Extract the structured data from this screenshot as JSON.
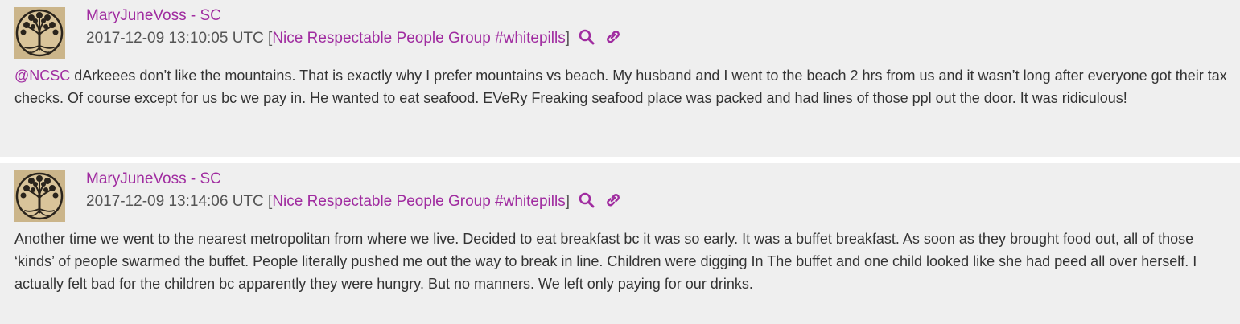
{
  "accent_color": "#a02ca0",
  "posts": [
    {
      "author": "MaryJuneVoss - SC",
      "timestamp": "2017-12-09 13:10:05 UTC",
      "open_bracket": "[",
      "group": "Nice Respectable People Group #whitepills",
      "close_bracket": "]",
      "search_icon": "search-icon",
      "link_icon": "link-icon",
      "mention": "@NCSC",
      "body": " dArkeees don’t like the mountains. That is exactly why I prefer mountains vs beach. My husband and I went to the beach 2 hrs from us and it wasn’t long after everyone got their tax checks. Of course except for us bc we pay in. He wanted to eat seafood. EVeRy Freaking seafood place was packed and had lines of those ppl out the door. It was ridiculous!"
    },
    {
      "author": "MaryJuneVoss - SC",
      "timestamp": "2017-12-09 13:14:06 UTC",
      "open_bracket": "[",
      "group": "Nice Respectable People Group #whitepills",
      "close_bracket": "]",
      "search_icon": "search-icon",
      "link_icon": "link-icon",
      "body": "Another time we went to the nearest metropolitan from where we live. Decided to eat breakfast bc it was so early. It was a buffet breakfast. As soon as they brought food out, all of those ‘kinds’ of people swarmed the buffet. People literally pushed me out the way to break in line. Children were digging In The buffet and one child looked like she had peed all over herself. I actually felt bad for the children bc apparently they were hungry. But no manners. We left only paying for our drinks."
    }
  ]
}
